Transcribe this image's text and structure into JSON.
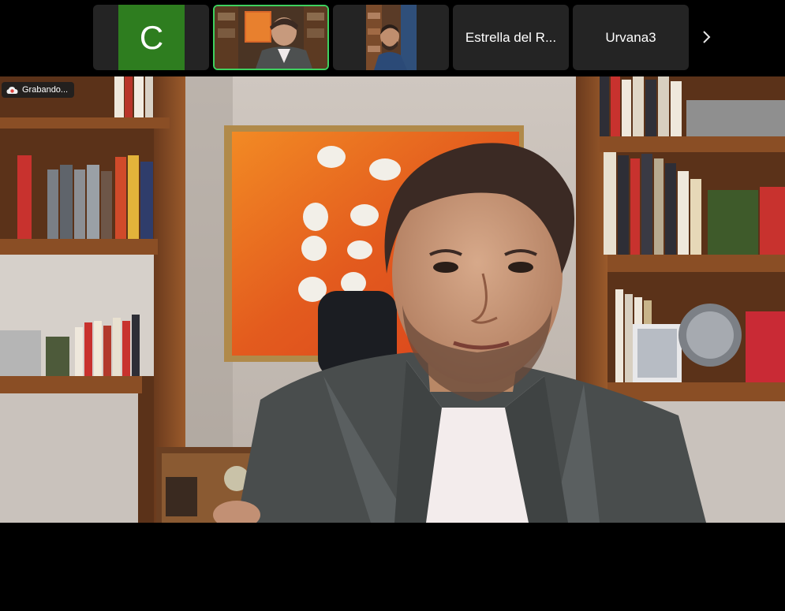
{
  "participants": [
    {
      "type": "avatar",
      "initial": "C",
      "avatar_color": "#2e7d1f"
    },
    {
      "type": "video",
      "active_speaker": true,
      "highlight_color": "#3ed15f"
    },
    {
      "type": "video"
    },
    {
      "type": "name",
      "name": "Estrella del R..."
    },
    {
      "type": "name",
      "name": "Urvana3"
    }
  ],
  "strip": {
    "next_icon": "chevron-right-icon"
  },
  "recording": {
    "label": "Grabando...",
    "icon": "cloud-recording-icon",
    "icon_color": "#e0443e"
  }
}
